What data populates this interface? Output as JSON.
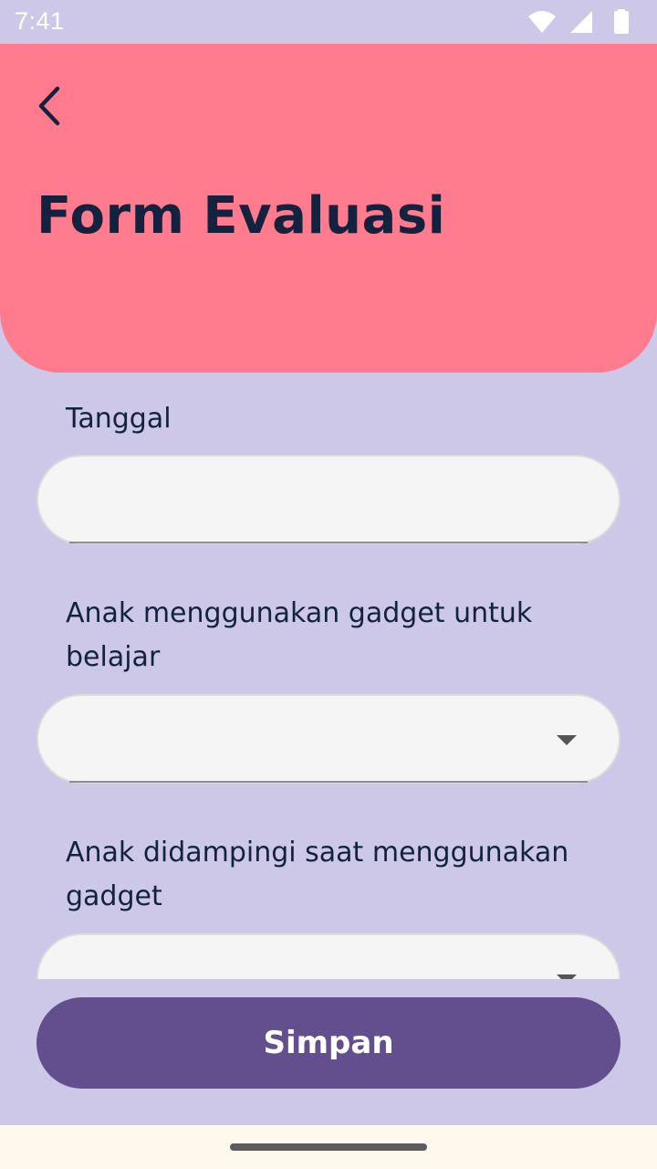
{
  "status_bar": {
    "time": "7:41",
    "icons": [
      "wifi-icon",
      "signal-icon",
      "battery-icon"
    ]
  },
  "header": {
    "back_icon": "back-arrow-icon",
    "title": "Form Evaluasi",
    "background_color": "#FF7B8D"
  },
  "form": {
    "fields": [
      {
        "label": "Tanggal",
        "value": "",
        "type": "text"
      },
      {
        "label": "Anak menggunakan gadget untuk belajar",
        "value": "",
        "type": "dropdown"
      },
      {
        "label": "Anak didampingi saat menggunakan gadget",
        "value": "",
        "type": "dropdown"
      }
    ]
  },
  "actions": {
    "save_label": "Simpan",
    "save_color": "#634F8D"
  },
  "colors": {
    "page_background": "#CDC8E8",
    "text": "#13233F"
  }
}
